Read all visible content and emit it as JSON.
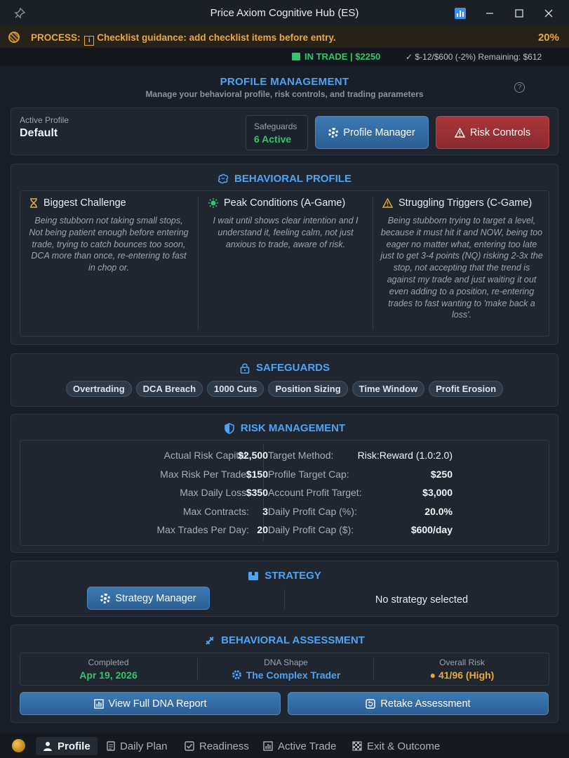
{
  "window": {
    "title": "Price Axiom Cognitive Hub (ES)"
  },
  "process": {
    "label": "PROCESS:",
    "message": "Checklist guidance: add checklist items before entry.",
    "percent": "20%"
  },
  "trade_status": {
    "in_trade": "IN TRADE | $2250",
    "remaining": "✓ $-12/$600 (-2%) Remaining: $612"
  },
  "header": {
    "title": "PROFILE MANAGEMENT",
    "subtitle": "Manage your behavioral profile, risk controls, and trading parameters"
  },
  "active_profile": {
    "label": "Active Profile",
    "name": "Default",
    "safeguards_label": "Safeguards",
    "safeguards_value": "6 Active",
    "profile_manager_button": "Profile Manager",
    "risk_controls_button": "Risk Controls"
  },
  "behavioral_profile": {
    "title": "BEHAVIORAL PROFILE",
    "columns": [
      {
        "heading": "Biggest Challenge",
        "icon": "hourglass-icon",
        "text": "Being stubborn not taking small stops, Not being patient enough before entering trade, trying to catch bounces too soon, DCA more than once, re-entering to fast in chop or."
      },
      {
        "heading": "Peak Conditions (A-Game)",
        "icon": "sun-icon",
        "text": "I wait until shows clear intention and I understand it, feeling calm, not just anxious to trade, aware of risk."
      },
      {
        "heading": "Struggling Triggers (C-Game)",
        "icon": "warning-icon",
        "text": "Being stubborn trying to target a level, because it must hit it and NOW, being too eager no matter what, entering too late just to get 3-4 points (NQ) risking 2-3x the stop, not accepting that the trend is against my trade and just waiting it out even adding to a position, re-entering trades to fast wanting to 'make back a loss'."
      }
    ]
  },
  "safeguards": {
    "title": "SAFEGUARDS",
    "chips": [
      "Overtrading",
      "DCA Breach",
      "1000 Cuts",
      "Position Sizing",
      "Time Window",
      "Profit Erosion"
    ]
  },
  "risk_management": {
    "title": "RISK MANAGEMENT",
    "left": [
      {
        "label": "Actual Risk Capital:",
        "value": "$2,500"
      },
      {
        "label": "Max Risk Per Trade:",
        "value": "$150"
      },
      {
        "label": "Max Daily Loss:",
        "value": "$350"
      },
      {
        "label": "Max Contracts:",
        "value": "3"
      },
      {
        "label": "Max Trades Per Day:",
        "value": "20"
      }
    ],
    "right": [
      {
        "label": "Target Method:",
        "value": "Risk:Reward (1.0:2.0)"
      },
      {
        "label": "Profile Target Cap:",
        "value": "$250"
      },
      {
        "label": "Account Profit Target:",
        "value": "$3,000"
      },
      {
        "label": "Daily Profit Cap (%):",
        "value": "20.0%"
      },
      {
        "label": "Daily Profit Cap ($):",
        "value": "$600/day"
      }
    ]
  },
  "strategy": {
    "title": "STRATEGY",
    "manager_button": "Strategy Manager",
    "status": "No strategy selected"
  },
  "assessment": {
    "title": "BEHAVIORAL ASSESSMENT",
    "completed_label": "Completed",
    "completed_value": "Apr 19, 2026",
    "dna_label": "DNA Shape",
    "dna_value": "The Complex Trader",
    "risk_label": "Overall Risk",
    "risk_value": "● 41/96 (High)",
    "view_button": "View Full DNA Report",
    "retake_button": "Retake Assessment"
  },
  "tabs": [
    "Profile",
    "Daily Plan",
    "Readiness",
    "Active Trade",
    "Exit & Outcome"
  ],
  "colors": {
    "accent": "#4ea3f2",
    "success": "#34c46a",
    "warning": "#e9a93e",
    "danger": "#9d3236"
  }
}
